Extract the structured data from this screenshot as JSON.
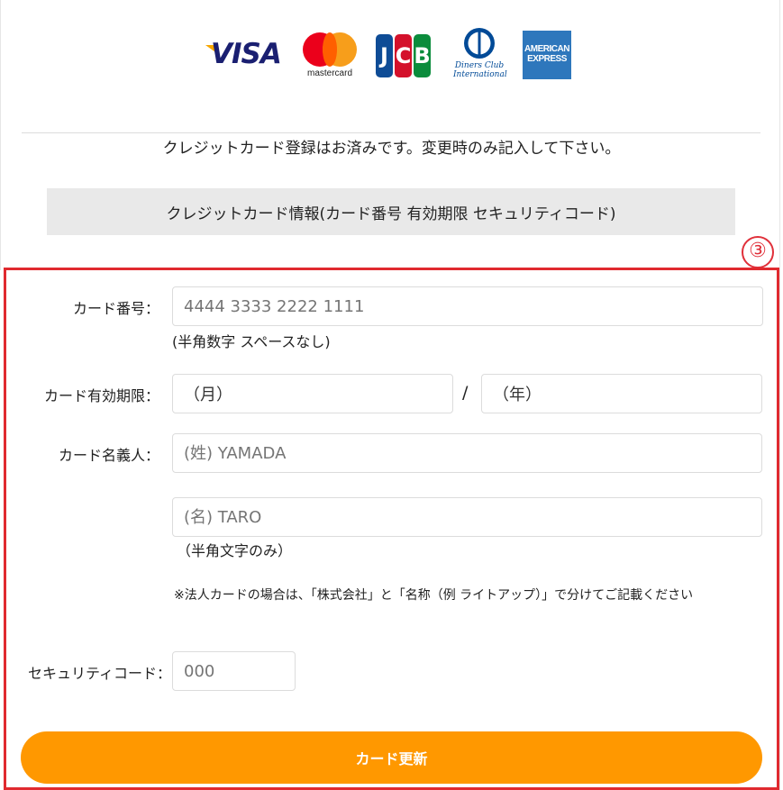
{
  "brands": {
    "visa": "VISA",
    "mastercard": "mastercard",
    "jcb": [
      "J",
      "C",
      "B"
    ],
    "diners_line1": "Diners Club",
    "diners_line2": "International",
    "amex_line1": "AMERICAN",
    "amex_line2": "EXPRESS"
  },
  "notice": "クレジットカード登録はお済みです。変更時のみ記入して下さい。",
  "info_bar": "クレジットカード情報(カード番号 有効期限 セキュリティコード)",
  "step_marker": "③",
  "form": {
    "card_number": {
      "label": "カード番号：",
      "placeholder": "4444 3333 2222 1111",
      "hint": "(半角数字 スペースなし)"
    },
    "expiry": {
      "label": "カード有効期限：",
      "month": "（月）",
      "separator": "/",
      "year": "（年）"
    },
    "holder": {
      "label": "カード名義人：",
      "last_placeholder": "(姓) YAMADA",
      "first_placeholder": "(名) TARO",
      "hint": "（半角文字のみ）",
      "note": "※法人カードの場合は、「株式会社」と「名称（例 ライトアップ）」で分けてご記載ください"
    },
    "security": {
      "label": "セキュリティコード：",
      "placeholder": "000"
    },
    "submit_label": "カード更新"
  },
  "colors": {
    "accent_orange": "#ff9800",
    "highlight_red": "#e02a2f",
    "info_bar_bg": "#e9e9e9"
  }
}
